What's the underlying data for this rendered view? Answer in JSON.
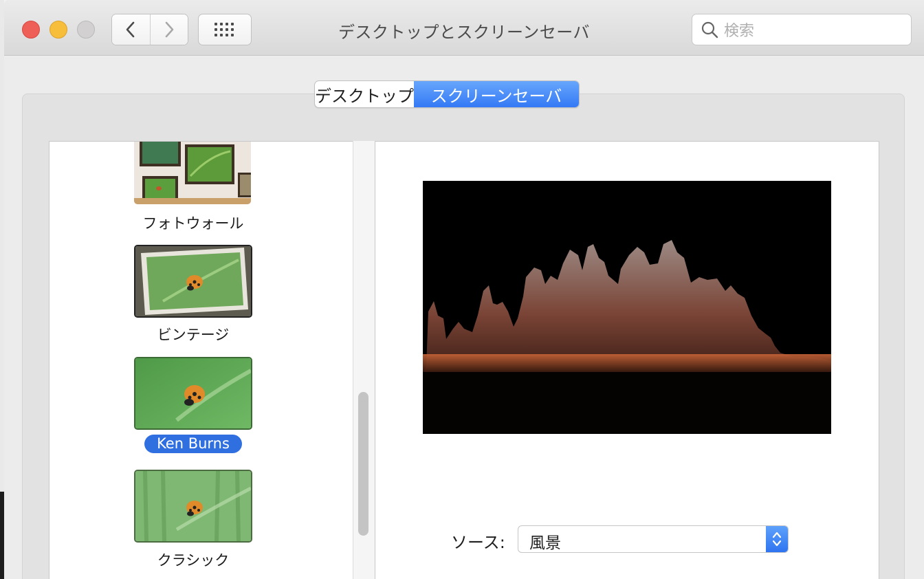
{
  "window": {
    "title": "デスクトップとスクリーンセーバ"
  },
  "search": {
    "placeholder": "検索"
  },
  "tabs": [
    {
      "label": "デスクトップ",
      "active": false
    },
    {
      "label": "スクリーンセーバ",
      "active": true
    }
  ],
  "screensavers": [
    {
      "label": "フォトウォール",
      "selected": false
    },
    {
      "label": "ビンテージ",
      "selected": false
    },
    {
      "label": "Ken Burns",
      "selected": true
    },
    {
      "label": "クラシック",
      "selected": false
    }
  ],
  "source": {
    "label": "ソース:",
    "value": "風景"
  },
  "colors": {
    "accent": "#3479f5",
    "selection": "#2f6fe0",
    "close": "#ee5f57",
    "minimize": "#f6be3b"
  }
}
